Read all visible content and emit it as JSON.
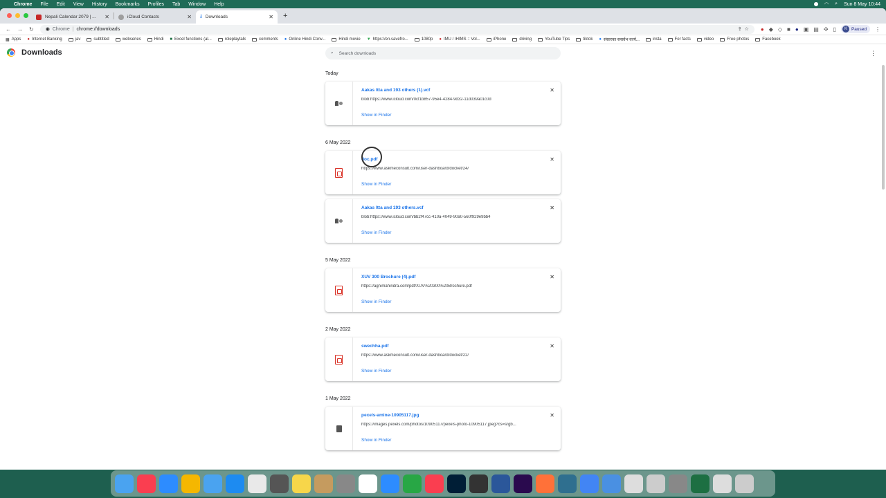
{
  "menubar": {
    "apple": "",
    "app": "Chrome",
    "items": [
      "File",
      "Edit",
      "View",
      "History",
      "Bookmarks",
      "Profiles",
      "Tab",
      "Window",
      "Help"
    ],
    "clock": "Sun 8 May  10:44"
  },
  "tabs": [
    {
      "title": "Nepali Calendar 2079 | ...",
      "color": "#c62828"
    },
    {
      "title": "iCloud Contacts",
      "color": "#9e9e9e"
    },
    {
      "title": "Downloads",
      "color": "#1a73e8"
    }
  ],
  "toolbar": {
    "omnibox_chip": "Chrome",
    "omnibox_url": "chrome://downloads",
    "profile_initial": "K",
    "profile_status": "Paused"
  },
  "bookmarks": [
    "Apps",
    "Internet Banking",
    "jav",
    "subtitled",
    "webseries",
    "Hindi",
    "Excel functions (al...",
    "roleplaytalk",
    "comments",
    "Online Hindi Conv...",
    "Hindi movie",
    "https://en.savefro...",
    "1080p",
    "IMU / IHIMS :: Vol...",
    "iPhone",
    "driving",
    "YouTube Tips",
    "tiktok",
    "संसारका ससर्वभ कार्य...",
    "insta",
    "For facts",
    "video",
    "Free photos",
    "Facebook"
  ],
  "page": {
    "title": "Downloads",
    "search_placeholder": "Search downloads"
  },
  "groups": [
    {
      "date": "Today",
      "items": [
        {
          "name": "Aakas Itta and 193 others (1).vcf",
          "url": "blob:https://www.icloud.com/0cf1b857-95e4-4284-9d32-11d039a01c0d",
          "action": "Show in Finder",
          "icon": "vcf"
        }
      ]
    },
    {
      "date": "6 May 2022",
      "items": [
        {
          "name": "doc.pdf",
          "url": "https://www.askmeconsult.com/user-dashboard/docket/24/",
          "action": "Show in Finder",
          "icon": "pdf"
        },
        {
          "name": "Aakas Itta and 193 others.vcf",
          "url": "blob:https://www.icloud.com/bb2f47cc-410a-4049-90a0-560f929e9bb4",
          "action": "Show in Finder",
          "icon": "vcf"
        }
      ]
    },
    {
      "date": "5 May 2022",
      "items": [
        {
          "name": "XUV 300 Brochure (4).pdf",
          "url": "https://agnimahindra.com/pdf/XUV%20300%20Brochure.pdf",
          "action": "Show in Finder",
          "icon": "pdf"
        }
      ]
    },
    {
      "date": "2 May 2022",
      "items": [
        {
          "name": "swechha.pdf",
          "url": "https://www.askmeconsult.com/user-dashboard/docket/22/",
          "action": "Show in Finder",
          "icon": "pdf"
        }
      ]
    },
    {
      "date": "1 May 2022",
      "items": [
        {
          "name": "pexels-amine-10905117.jpg",
          "url": "https://images.pexels.com/photos/10905117/pexels-photo-10905117.jpeg?cs=srgb...",
          "action": "Show in Finder",
          "icon": "image"
        }
      ]
    }
  ],
  "dock_colors": [
    "#4aa3f0",
    "#fa3e50",
    "#2d8cff",
    "#f5b700",
    "#4aa3f0",
    "#1d8bf1",
    "#e9e9e9",
    "#555555",
    "#f7d64a",
    "#c59b5f",
    "#888888",
    "#ffffff",
    "#2d8cff",
    "#28a745",
    "#fa3e50",
    "#001e36",
    "#333333",
    "#2b579a",
    "#2a0a4e",
    "#ff7139",
    "#2f6f8f",
    "#4285f4",
    "#4a90e2",
    "#dddddd",
    "#cccccc",
    "#888888",
    "#1d6f42",
    "#dddddd",
    "#cccccc"
  ]
}
